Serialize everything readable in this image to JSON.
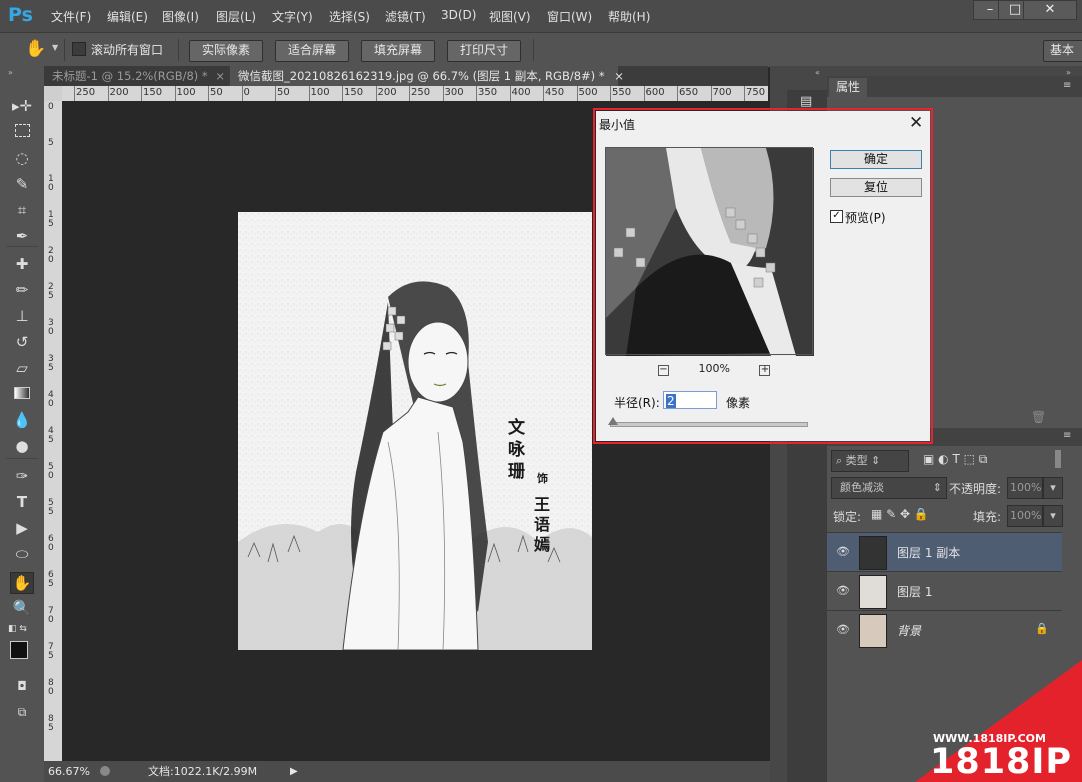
{
  "app": {
    "logo": "Ps"
  },
  "menu": [
    "文件(F)",
    "编辑(E)",
    "图像(I)",
    "图层(L)",
    "文字(Y)",
    "选择(S)",
    "滤镜(T)",
    "3D(D)",
    "视图(V)",
    "窗口(W)",
    "帮助(H)"
  ],
  "window_controls": {
    "minimize": "–",
    "maximize": "□",
    "close": "✕"
  },
  "options_bar": {
    "scroll_all_label": "滚动所有窗口",
    "buttons": [
      "实际像素",
      "适合屏幕",
      "填充屏幕",
      "打印尺寸"
    ],
    "workspace": "基本"
  },
  "tabs": [
    {
      "label": "未标题-1 @ 15.2%(RGB/8) *",
      "close": "×"
    },
    {
      "label": "微信截图_20210826162319.jpg @ 66.7% (图层 1 副本, RGB/8#) *",
      "close": "×"
    }
  ],
  "ruler_top": [
    "250",
    "200",
    "150",
    "100",
    "50",
    "0",
    "50",
    "100",
    "150",
    "200",
    "250",
    "300",
    "350",
    "400",
    "450",
    "500",
    "550",
    "600",
    "650",
    "700",
    "750"
  ],
  "ruler_left": [
    "0",
    "5",
    "10",
    "15",
    "20",
    "25",
    "30",
    "35",
    "40",
    "45",
    "50",
    "55",
    "60",
    "65",
    "70",
    "75",
    "80",
    "85"
  ],
  "canvas_text": {
    "col1": "文咏珊",
    "small": "饰",
    "col2": "王语嫣"
  },
  "status": {
    "zoom": "66.67%",
    "doc": "文档:1022.1K/2.99M"
  },
  "properties_panel": {
    "title": "属性"
  },
  "layers_panel": {
    "kind_filter": "类型",
    "blend_mode": "颜色减淡",
    "opacity_label": "不透明度:",
    "opacity_value": "100%",
    "lock_label": "锁定:",
    "fill_label": "填充:",
    "fill_value": "100%",
    "layers": [
      {
        "name": "图层 1 副本",
        "selected": true
      },
      {
        "name": "图层 1",
        "selected": false
      },
      {
        "name": "背景",
        "selected": false,
        "locked": true
      }
    ]
  },
  "dialog": {
    "title": "最小值",
    "ok": "确定",
    "reset": "复位",
    "preview_label": "预览(P)",
    "preview_checked": true,
    "zoom": "100%",
    "radius_label": "半径(R):",
    "radius_value": "2",
    "unit": "像素"
  },
  "watermark": {
    "url": "WWW.1818IP.COM",
    "brand": "1818IP"
  },
  "colors": {
    "accent": "#36a6e6",
    "highlight": "#e8232d",
    "selected_layer": "#4f5d72"
  }
}
